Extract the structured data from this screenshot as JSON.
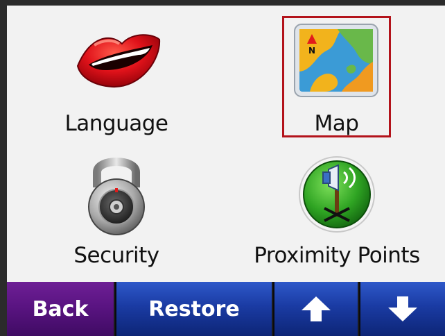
{
  "tiles": {
    "language": {
      "label": "Language",
      "icon": "lips-icon"
    },
    "map": {
      "label": "Map",
      "icon": "map-icon",
      "selected": true
    },
    "security": {
      "label": "Security",
      "icon": "padlock-icon"
    },
    "proximity": {
      "label": "Proximity Points",
      "icon": "proximity-speaker-icon"
    }
  },
  "selected_outline_color": "#b3131b",
  "bottom_bar": {
    "back_label": "Back",
    "restore_label": "Restore",
    "up_icon": "arrow-up-icon",
    "down_icon": "arrow-down-icon"
  },
  "colors": {
    "back_button": "#5a1482",
    "blue_buttons": "#1a3ba3",
    "panel_background": "#f2f2f2"
  }
}
